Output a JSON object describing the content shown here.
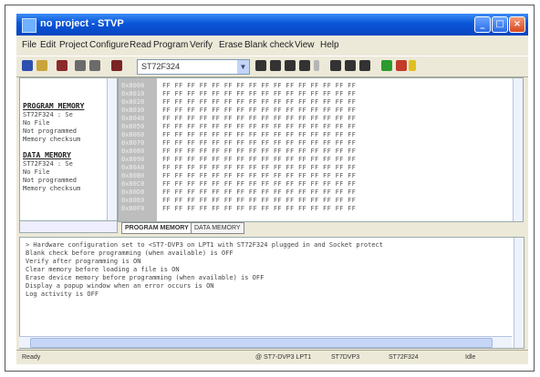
{
  "window": {
    "title": "no project - STVP",
    "minimize": "_",
    "maximize": "□",
    "close": "×"
  },
  "menu": [
    "File",
    "Edit",
    "Project",
    "Configure",
    "Read",
    "Program",
    "Verify",
    "Erase",
    "Blank check",
    "View",
    "Help"
  ],
  "toolbar": {
    "device": "ST72F324",
    "buttons": [
      "save-tool",
      "open-tool",
      "read-tool",
      "program-tool",
      "verify-tool",
      "erase-tool",
      "blank-check-tool",
      "config-tool"
    ]
  },
  "left_pane": {
    "program_header": "PROGRAM MEMORY",
    "program_lines": [
      "ST72F324 : Se",
      "No File",
      "Not programmed",
      "Memory checksum"
    ],
    "data_header": "DATA MEMORY",
    "data_lines": [
      "ST72F324 : Se",
      "No File",
      "Not programmed",
      "Memory checksum"
    ]
  },
  "hex": {
    "addresses": [
      "0x8000",
      "0x8010",
      "0x8020",
      "0x8030",
      "0x8040",
      "0x8050",
      "0x8060",
      "0x8070",
      "0x8080",
      "0x8090",
      "0x80A0",
      "0x80B0",
      "0x80C0",
      "0x80D0",
      "0x80E0",
      "0x80F0"
    ],
    "row_text": "FF FF FF FF FF FF FF FF FF FF FF FF FF FF FF FF"
  },
  "tabs": [
    "PROGRAM MEMORY",
    "DATA MEMORY"
  ],
  "log": [
    "> Hardware configuration set to <ST7-DVP3 on LPT1 with ST72F324 plugged in and Socket protect",
    "  Blank check before programming (when available) is OFF",
    "  Verify after programming is ON",
    "  Clear memory before loading a file is ON",
    "  Erase device memory before programming (when available) is OFF",
    "  Display a popup window when an error occurs is ON",
    "  Log activity is OFF"
  ],
  "status": {
    "ready": "Ready",
    "port": "@ ST7-DVP3 LPT1",
    "mode": "ST7DVP3",
    "device": "ST72F324",
    "state": "Idle"
  },
  "colors": {
    "titlebar": "#0a56d8",
    "window_bg": "#ece9d8",
    "address_column": "#bdbdbd"
  }
}
